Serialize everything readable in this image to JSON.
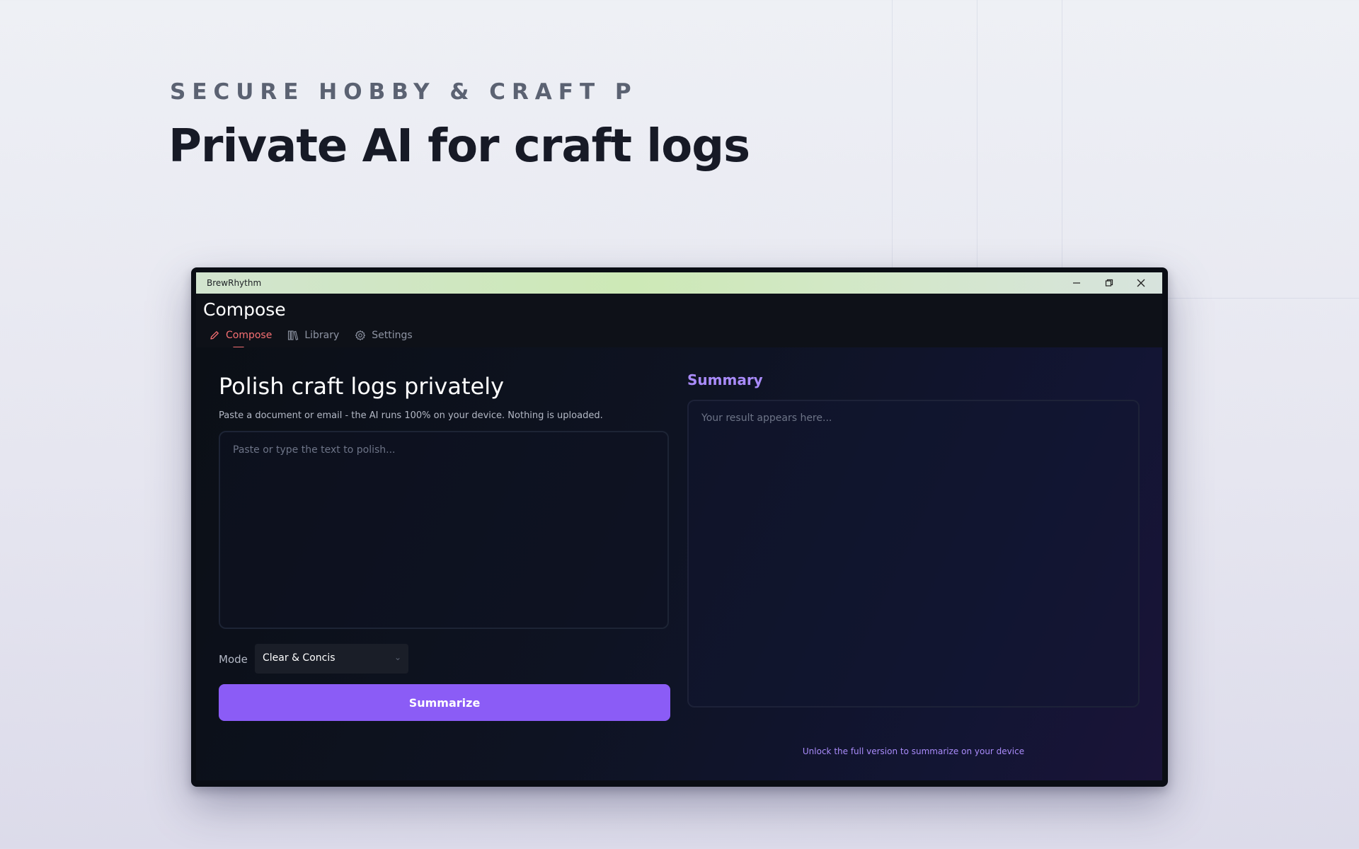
{
  "hero": {
    "eyebrow": "SECURE HOBBY & CRAFT P",
    "title": "Private AI for craft logs"
  },
  "window": {
    "app_name": "BrewRhythm",
    "controls": [
      "minimize-icon",
      "restore-icon",
      "close-icon"
    ]
  },
  "header": {
    "page_title": "Compose",
    "tabs": [
      {
        "label": "Compose",
        "icon": "pencil-icon",
        "active": true
      },
      {
        "label": "Library",
        "icon": "library-icon",
        "active": false
      },
      {
        "label": "Settings",
        "icon": "gear-icon",
        "active": false
      }
    ]
  },
  "main": {
    "heading": "Polish craft logs privately",
    "subtitle": "Paste a document or email - the AI runs 100% on your device. Nothing is uploaded.",
    "input_placeholder": "Paste or type the text to polish...",
    "mode_label": "Mode",
    "mode_value": "Clear & Concis",
    "action_label": "Summarize"
  },
  "summary": {
    "title": "Summary",
    "placeholder": "Your result appears here...",
    "unlock_text": "Unlock the full version to summarize on your device"
  },
  "colors": {
    "accent": "#8b5cf6",
    "active_tab": "#f56f72",
    "summary_accent": "#a98bfa"
  }
}
